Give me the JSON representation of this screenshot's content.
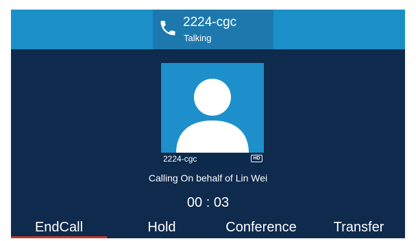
{
  "header": {
    "contact_name": "2224-cgc",
    "status": "Talking",
    "icon": "phone-icon"
  },
  "call": {
    "avatar_name": "2224-cgc",
    "hd_badge": "HD",
    "calling_text": "Calling On behalf of Lin Wei",
    "timer": "00 : 03"
  },
  "softkeys": [
    {
      "label": "EndCall"
    },
    {
      "label": "Hold"
    },
    {
      "label": "Conference"
    },
    {
      "label": "Transfer"
    }
  ],
  "colors": {
    "background": "#0e2a4d",
    "top_bar": "#1b90c8",
    "title_box": "#1d79ad",
    "avatar_bg": "#1d8fcb",
    "text": "#ffffff"
  }
}
